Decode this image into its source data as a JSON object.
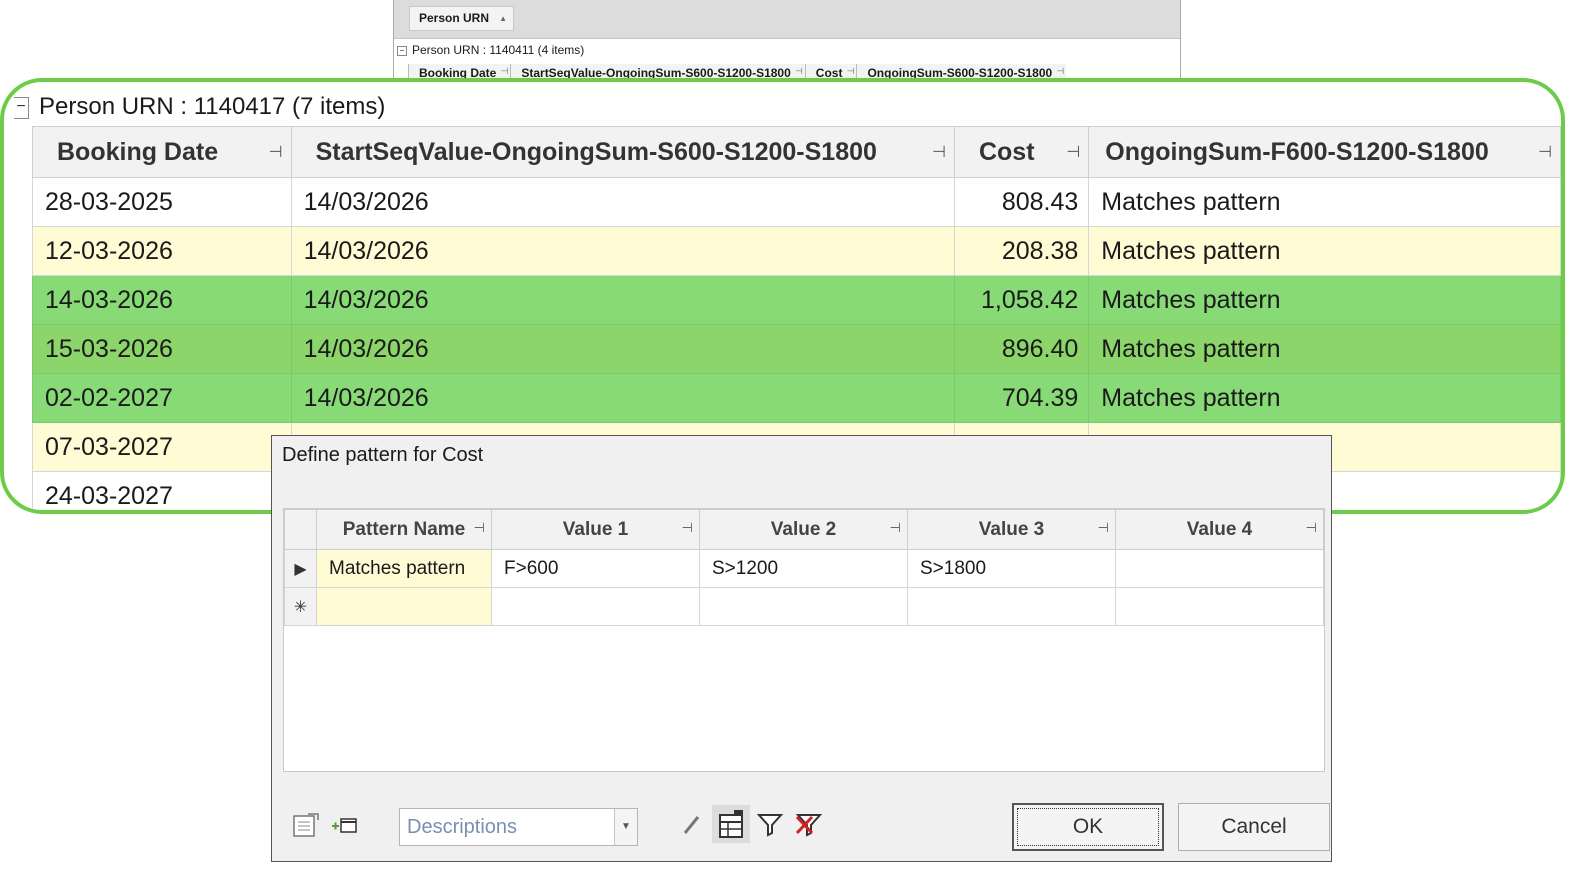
{
  "background_grid": {
    "group_chip_label": "Person URN",
    "group_row": "Person URN : 1140411 (4 items)",
    "columns": [
      "Booking Date",
      "StartSeqValue-OngoingSum-S600-S1200-S1800",
      "Cost",
      "OngoingSum-S600-S1200-S1800"
    ]
  },
  "zoom_grid": {
    "group_row": "Person URN : 1140417 (7 items)",
    "columns": [
      "Booking Date",
      "StartSeqValue-OngoingSum-S600-S1200-S1800",
      "Cost",
      "OngoingSum-F600-S1200-S1800"
    ],
    "rows": [
      {
        "booking_date": "28-03-2025",
        "start_seq": "14/03/2026",
        "cost": "808.43",
        "ongoing": "Matches pattern"
      },
      {
        "booking_date": "12-03-2026",
        "start_seq": "14/03/2026",
        "cost": "208.38",
        "ongoing": "Matches pattern"
      },
      {
        "booking_date": "14-03-2026",
        "start_seq": "14/03/2026",
        "cost": "1,058.42",
        "ongoing": "Matches pattern"
      },
      {
        "booking_date": "15-03-2026",
        "start_seq": "14/03/2026",
        "cost": "896.40",
        "ongoing": "Matches pattern"
      },
      {
        "booking_date": "02-02-2027",
        "start_seq": "14/03/2026",
        "cost": "704.39",
        "ongoing": "Matches pattern"
      },
      {
        "booking_date": "07-03-2027",
        "start_seq": "",
        "cost": "",
        "ongoing": ""
      },
      {
        "booking_date": "24-03-2027",
        "start_seq": "",
        "cost": "",
        "ongoing": ""
      }
    ],
    "highlight_color": "#88da77",
    "alt_row_color": "#fffbd5"
  },
  "dialog": {
    "title": "Define pattern for Cost",
    "columns": [
      "Pattern Name",
      "Value 1",
      "Value 2",
      "Value 3",
      "Value 4"
    ],
    "rows": [
      {
        "name": "Matches pattern",
        "v1": "F>600",
        "v2": "S>1200",
        "v3": "S>1800",
        "v4": ""
      }
    ],
    "new_row_indicator": "✳",
    "current_row_indicator": "▶",
    "descriptions_value": "Descriptions",
    "ok_label": "OK",
    "cancel_label": "Cancel",
    "footer_icons": [
      "properties-icon",
      "add-row-icon",
      "pencil-icon",
      "grid-icon",
      "filter-icon",
      "clear-filter-icon"
    ]
  }
}
